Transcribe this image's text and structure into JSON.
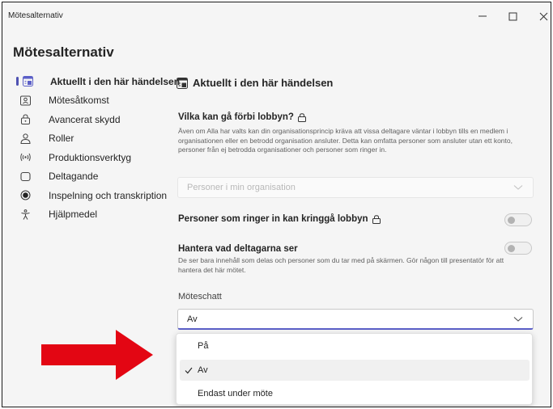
{
  "window": {
    "title": "Mötesalternativ",
    "controls": {
      "minimize": "—",
      "maximize": "☐",
      "close": "✕"
    }
  },
  "page": {
    "title": "Mötesalternativ"
  },
  "sidebar": {
    "items": [
      {
        "label": "Aktuellt i den här händelsen",
        "icon": "event-list-icon",
        "active": true
      },
      {
        "label": "Mötesåtkomst",
        "icon": "person-badge-icon",
        "active": false
      },
      {
        "label": "Avancerat skydd",
        "icon": "lock-icon",
        "active": false
      },
      {
        "label": "Roller",
        "icon": "people-icon",
        "active": false
      },
      {
        "label": "Produktionsverktyg",
        "icon": "broadcast-icon",
        "active": false
      },
      {
        "label": "Deltagande",
        "icon": "chat-bubble-icon",
        "active": false
      },
      {
        "label": "Inspelning och transkription",
        "icon": "record-icon",
        "active": false
      },
      {
        "label": "Hjälpmedel",
        "icon": "accessibility-icon",
        "active": false
      }
    ]
  },
  "content": {
    "section_title": "Aktuellt i den här händelsen",
    "lobby_bypass": {
      "heading": "Vilka kan gå förbi lobbyn?",
      "description": "Även om Alla har valts kan din organisationsprincip kräva att vissa deltagare väntar i lobbyn tills en medlem i organisationen eller en betrodd organisation ansluter. Detta kan omfatta personer som ansluter utan ett konto, personer från ej betrodda organisationer och personer som ringer in.",
      "select_value": "Personer i min organisation",
      "disabled": true
    },
    "dial_in_bypass": {
      "heading": "Personer som ringer in kan kringgå lobbyn",
      "enabled": false
    },
    "manage_view": {
      "heading": "Hantera vad deltagarna ser",
      "description": "De ser bara innehåll som delas och personer som du tar med på skärmen. Gör någon till presentatör för att hantera det här mötet.",
      "enabled": false
    },
    "meeting_chat": {
      "label": "Möteschatt",
      "value": "Av",
      "options": [
        {
          "label": "På",
          "selected": false
        },
        {
          "label": "Av",
          "selected": true
        },
        {
          "label": "Endast under möte",
          "selected": false
        }
      ]
    }
  },
  "colors": {
    "accent": "#5b5fc7",
    "annotation_arrow": "#e30613",
    "window_bg": "#f5f5f5"
  }
}
